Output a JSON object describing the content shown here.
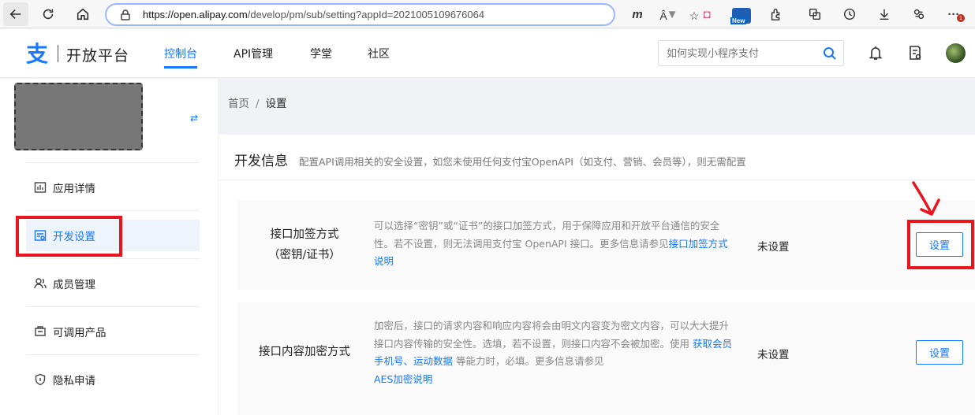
{
  "browser": {
    "url_host": "https://open.alipay.com",
    "url_path": "/develop/pm/sub/setting?appId=2021005109676064",
    "read_aloud_glyph": "Â",
    "new_badge": "New",
    "notification_count": "1"
  },
  "header": {
    "logo_mark": "支",
    "logo_text": "开放平台",
    "nav": [
      "控制台",
      "API管理",
      "学堂",
      "社区"
    ],
    "search_placeholder": "如何实现小程序支付"
  },
  "sidebar": {
    "swap_glyph": "⇄",
    "items": [
      {
        "label": "应用详情",
        "icon": "chart-icon"
      },
      {
        "label": "开发设置",
        "icon": "dev-settings-icon"
      },
      {
        "label": "成员管理",
        "icon": "members-icon"
      },
      {
        "label": "可调用产品",
        "icon": "products-icon"
      },
      {
        "label": "隐私申请",
        "icon": "privacy-icon"
      }
    ]
  },
  "breadcrumb": {
    "home": "首页",
    "separator": "/",
    "current": "设置"
  },
  "card": {
    "title": "开发信息",
    "subtitle": "配置API调用相关的安全设置，如您未使用任何支付宝OpenAPI（如支付、营销、会员等），则无需配置",
    "rows": [
      {
        "name_line1": "接口加签方式",
        "name_line2": "（密钥/证书）",
        "desc_text": "可以选择“密钥”或“证书”的接口加签方式，用于保障应用和开放平台通信的安全性。若不设置，则无法调用支付宝 OpenAPI 接口。更多信息请参见",
        "desc_link": "接口加签方式说明",
        "status": "未设置",
        "button": "设置"
      },
      {
        "name_line1": "接口内容加密方式",
        "desc_text_1": "加密后，接口的请求内容和响应内容将会由明文内容变为密文内容，可以大大提升接口内容传输的安全性。选填，若不设置，则接口内容不会被加密。使用 ",
        "desc_link_1": "获取会员手机号",
        "desc_sep": "、",
        "desc_link_2": "运动数据",
        "desc_text_2": " 等能力时，必填。更多信息请参见",
        "desc_link_3": "AES加密说明",
        "status": "未设置",
        "button": "设置"
      }
    ]
  },
  "colors": {
    "accent": "#1677ff",
    "annotation_red": "#e8141e"
  }
}
